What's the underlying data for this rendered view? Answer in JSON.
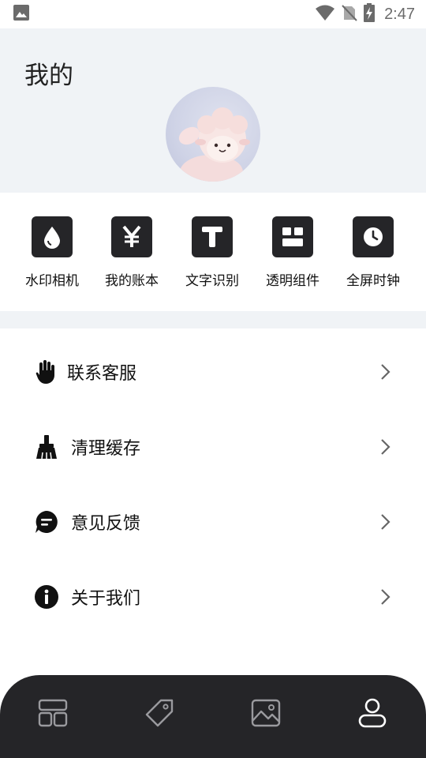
{
  "status_bar": {
    "time": "2:47",
    "icons": [
      "image-notification-icon",
      "wifi-icon",
      "no-sim-icon",
      "battery-charging-icon"
    ]
  },
  "header": {
    "title": "我的",
    "avatar": "avatar-sheep-plush"
  },
  "quick_actions": [
    {
      "label": "水印相机",
      "icon": "water-drop-icon"
    },
    {
      "label": "我的账本",
      "icon": "yen-icon"
    },
    {
      "label": "文字识别",
      "icon": "text-t-icon"
    },
    {
      "label": "透明组件",
      "icon": "widget-grid-icon"
    },
    {
      "label": "全屏时钟",
      "icon": "clock-icon"
    }
  ],
  "menu": [
    {
      "label": "联系客服",
      "icon": "hand-icon"
    },
    {
      "label": "清理缓存",
      "icon": "broom-icon"
    },
    {
      "label": "意见反馈",
      "icon": "chat-bubble-icon"
    },
    {
      "label": "关于我们",
      "icon": "info-icon"
    }
  ],
  "bottom_nav": {
    "items": [
      {
        "icon": "dashboard-layout-icon",
        "active": false
      },
      {
        "icon": "tag-icon",
        "active": false
      },
      {
        "icon": "gallery-image-icon",
        "active": false
      },
      {
        "icon": "user-profile-icon",
        "active": true
      }
    ]
  },
  "colors": {
    "header_bg": "#f0f3f6",
    "dark": "#252528",
    "nav_inactive": "#9a9a9e",
    "nav_active": "#ffffff"
  }
}
